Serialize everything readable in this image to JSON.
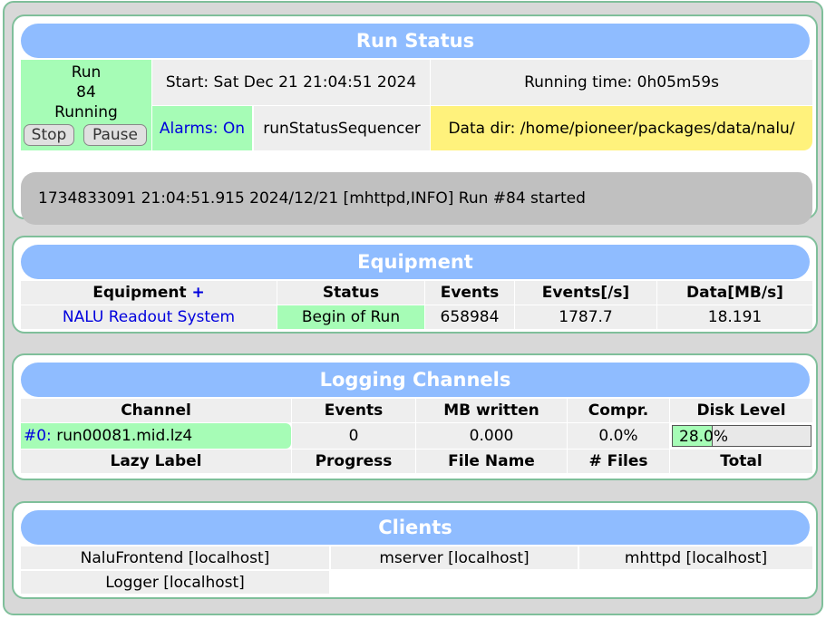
{
  "run_status": {
    "title": "Run Status",
    "run_label": "Run",
    "run_number": "84",
    "run_state": "Running",
    "stop_button": "Stop",
    "pause_button": "Pause",
    "start_time": "Start: Sat Dec 21 21:04:51 2024",
    "running_time": "Running time: 0h05m59s",
    "alarms_label": "Alarms:",
    "alarms_value": "On",
    "sequencer": "runStatusSequencer",
    "data_dir": "Data dir: /home/pioneer/packages/data/nalu/",
    "message": "1734833091 21:04:51.915 2024/12/21 [mhttpd,INFO] Run #84 started"
  },
  "equipment": {
    "title": "Equipment",
    "headers": {
      "equipment": "Equipment",
      "add": "+",
      "status": "Status",
      "events": "Events",
      "rate": "Events[/s]",
      "data": "Data[MB/s]"
    },
    "rows": [
      {
        "name": "NALU Readout System",
        "status": "Begin of Run",
        "events": "658984",
        "rate": "1787.7",
        "data": "18.191"
      }
    ]
  },
  "logging": {
    "title": "Logging Channels",
    "headers": {
      "channel": "Channel",
      "events": "Events",
      "mb": "MB written",
      "compr": "Compr.",
      "disk": "Disk Level"
    },
    "rows": [
      {
        "index": "#0:",
        "file": "run00081.mid.lz4",
        "events": "0",
        "mb": "0.000",
        "compr": "0.0%",
        "disk_level": 0.28,
        "disk_text_a": "28.0",
        "disk_text_b": "%"
      }
    ],
    "lazy_headers": {
      "label": "Lazy Label",
      "progress": "Progress",
      "filename": "File Name",
      "files": "# Files",
      "total": "Total"
    }
  },
  "clients": {
    "title": "Clients",
    "items": [
      "NaluFrontend [localhost]",
      "mserver [localhost]",
      "mhttpd [localhost]",
      "Logger [localhost]"
    ]
  },
  "colors": {
    "header_blue": "#8fbcff",
    "status_green": "#a6fcb6",
    "data_dir_yellow": "#fff27c",
    "message_grey": "#c0c0c0",
    "panel_border": "#7fbf9a",
    "link_blue": "#0000dd"
  }
}
